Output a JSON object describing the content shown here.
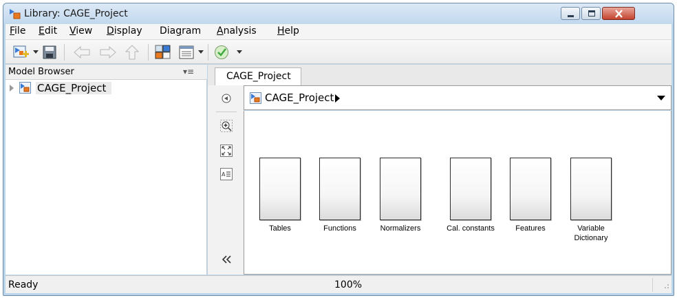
{
  "window": {
    "title": "Library: CAGE_Project",
    "controls": [
      "minimize",
      "maximize",
      "close"
    ]
  },
  "menu": [
    {
      "label": "File",
      "key": "F",
      "rest": "ile"
    },
    {
      "label": "Edit",
      "key": "E",
      "rest": "dit"
    },
    {
      "label": "View",
      "key": "V",
      "rest": "iew"
    },
    {
      "label": "Display",
      "key": "D",
      "rest": "isplay"
    },
    {
      "label": "Diagram",
      "pre": "Dia",
      "key": "g",
      "rest": "ram"
    },
    {
      "label": "Analysis",
      "key": "A",
      "rest": "nalysis"
    },
    {
      "label": "Help",
      "key": "H",
      "rest": "elp"
    }
  ],
  "toolbar": {
    "icons": [
      "new-model-icon",
      "save-icon",
      "back-arrow-icon",
      "forward-arrow-icon",
      "up-arrow-icon",
      "library-browser-icon",
      "model-explorer-icon",
      "check-icon"
    ]
  },
  "model_browser": {
    "title": "Model Browser",
    "menu_glyph": "▾≡",
    "tree": [
      {
        "label": "CAGE_Project"
      }
    ]
  },
  "tabs": [
    {
      "label": "CAGE_Project"
    }
  ],
  "address": {
    "path": "CAGE_Project"
  },
  "blocks": [
    {
      "label_line1": "Tables",
      "label_line2": ""
    },
    {
      "label_line1": "Functions",
      "label_line2": ""
    },
    {
      "label_line1": "Normalizers",
      "label_line2": ""
    },
    {
      "label_line1": "Cal. constants",
      "label_line2": ""
    },
    {
      "label_line1": "Features",
      "label_line2": ""
    },
    {
      "label_line1": "Variable",
      "label_line2": "Dictionary"
    }
  ],
  "status": {
    "text": "Ready",
    "zoom": "100%"
  },
  "colors": {
    "title_gradient_top": "#dce9f6",
    "close_button": "#c2432e",
    "accent_orange": "#e8791e",
    "accent_blue": "#3a7bd5",
    "check_green": "#3fa83f"
  }
}
